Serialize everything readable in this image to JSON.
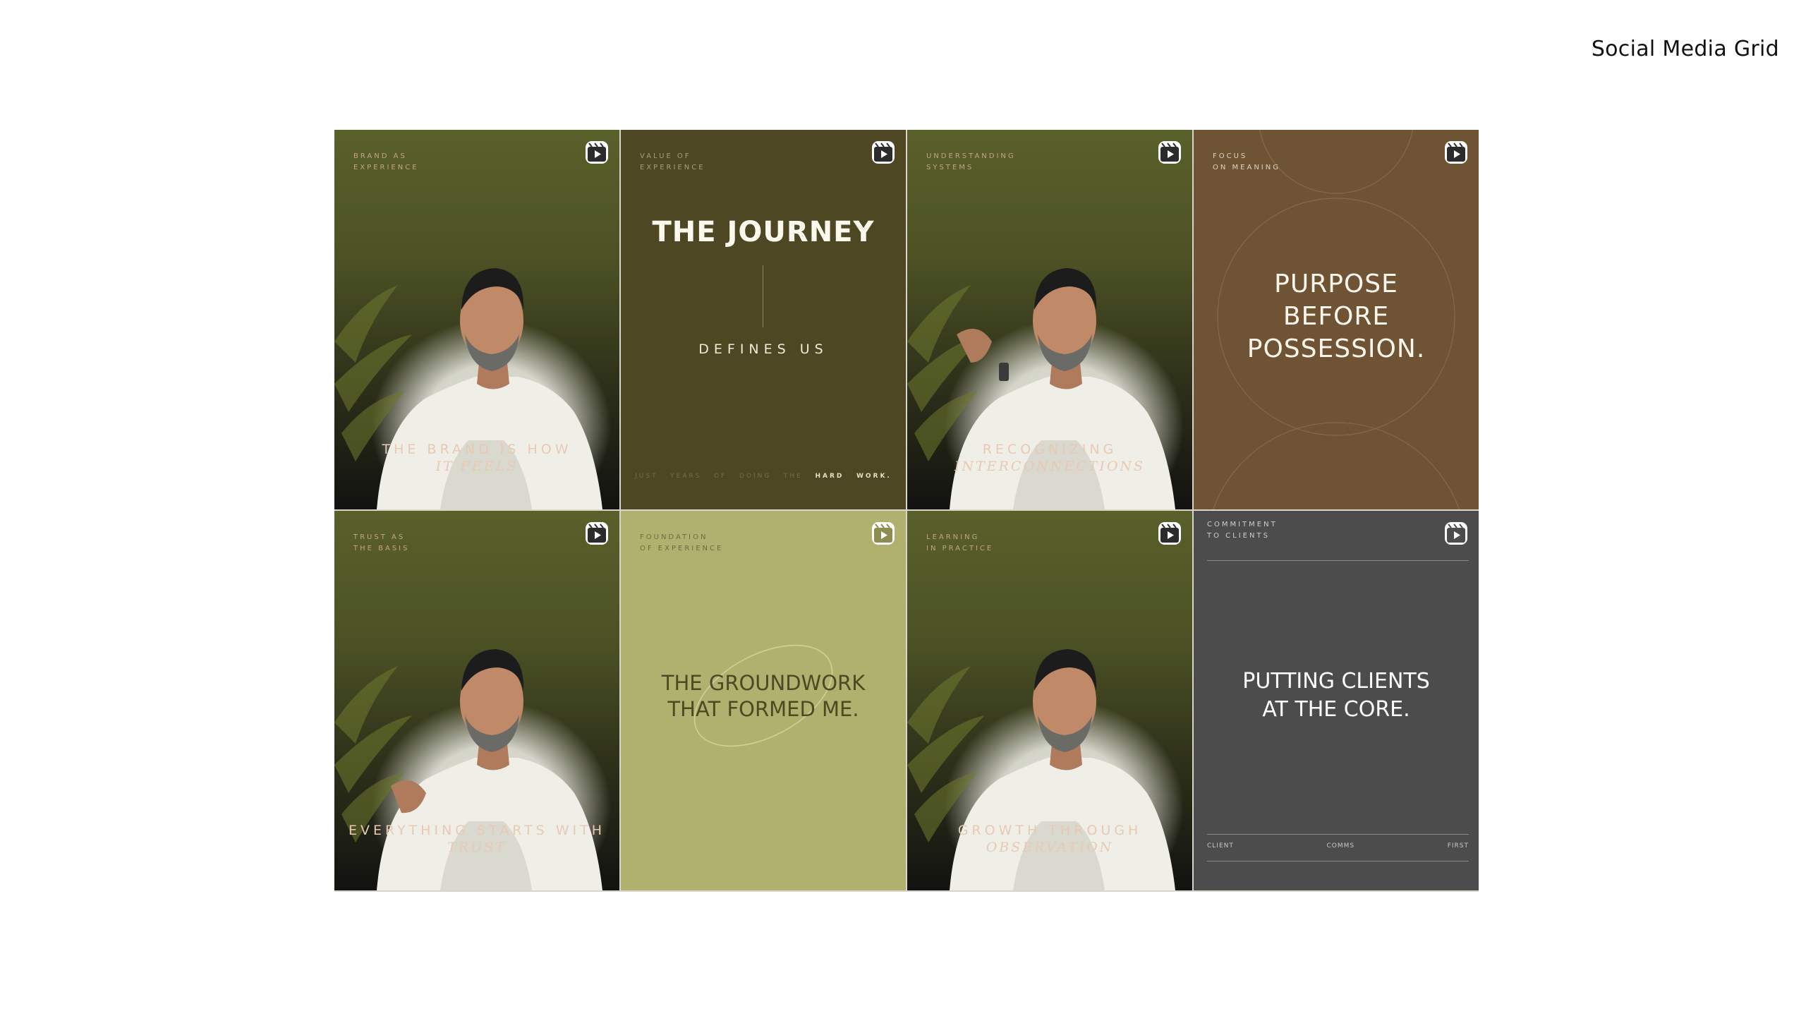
{
  "page": {
    "title": "Social Media Grid"
  },
  "icons": {
    "reel": "reels-play-icon"
  },
  "tiles": [
    {
      "kind": "photo",
      "eyebrow": "BRAND AS\nEXPERIENCE",
      "line1": "THE BRAND IS HOW",
      "line2": "IT FEELS"
    },
    {
      "kind": "text",
      "eyebrow": "VALUE OF\nEXPERIENCE",
      "headline": "THE JOURNEY",
      "sub": "DEFINES US",
      "footer_words": [
        "JUST",
        "YEARS",
        "OF",
        "DOING",
        "THE"
      ],
      "footer_bold": [
        "HARD",
        "WORK."
      ]
    },
    {
      "kind": "photo",
      "eyebrow": "UNDERSTANDING\nSYSTEMS",
      "line1": "RECOGNIZING",
      "line2": "INTERCONNECTIONS"
    },
    {
      "kind": "text",
      "eyebrow": "FOCUS\nON MEANING",
      "headline": "PURPOSE\nBEFORE\nPOSSESSION."
    },
    {
      "kind": "photo",
      "eyebrow": "TRUST AS\nTHE BASIS",
      "line1": "EVERYTHING STARTS WITH",
      "line2": "TRUST"
    },
    {
      "kind": "text",
      "eyebrow": "FOUNDATION\nOF EXPERIENCE",
      "headline": "THE GROUNDWORK\nTHAT FORMED ME."
    },
    {
      "kind": "photo",
      "eyebrow": "LEARNING\nIN PRACTICE",
      "line1": "GROWTH THROUGH",
      "line2": "OBSERVATION"
    },
    {
      "kind": "text",
      "eyebrow": "COMMITMENT\nTO CLIENTS",
      "headline": "PUTTING CLIENTS\nAT THE CORE.",
      "foot": [
        "CLIENT",
        "COMMS",
        "FIRST"
      ]
    }
  ],
  "colors": {
    "photo_bg": "#4b5124",
    "journey_bg": "#4d4724",
    "purpose_bg": "#6e5434",
    "groundwork_bg": "#b1b16f",
    "clients_bg": "#4c4c4c",
    "caption": "#e8c9b4"
  }
}
